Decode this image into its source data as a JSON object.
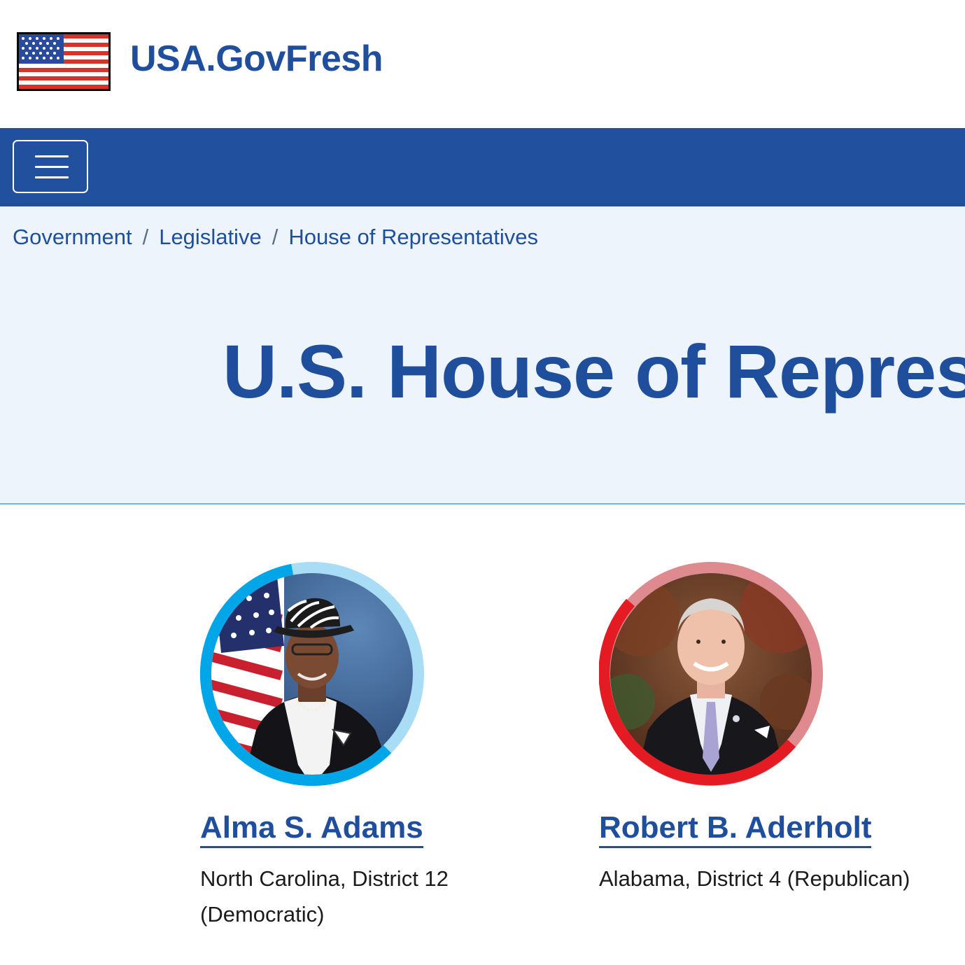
{
  "site": {
    "title": "USA.GovFresh"
  },
  "nav": {
    "menu_icon": "hamburger-menu-icon"
  },
  "breadcrumb": [
    {
      "label": "Government"
    },
    {
      "label": "Legislative"
    },
    {
      "label": "House of Representatives"
    }
  ],
  "breadcrumb_separator": "/",
  "page": {
    "title": "U.S. House of Representatives"
  },
  "colors": {
    "brand_blue": "#1f4f9c",
    "nav_blue": "#20509e",
    "hero_bg": "#edf4fc",
    "democratic_ring": "#00a6e8",
    "democratic_ring_light": "#a9dcf5",
    "republican_ring": "#e51b24",
    "republican_ring_light": "#de8a8e"
  },
  "representatives": [
    {
      "name": "Alma S. Adams",
      "meta_line1": "North Carolina, District 12",
      "meta_line2": "(Democratic)"
    },
    {
      "name": "Robert B. Aderholt",
      "meta_line1": "Alabama, District 4 (Republican)",
      "meta_line2": ""
    }
  ]
}
